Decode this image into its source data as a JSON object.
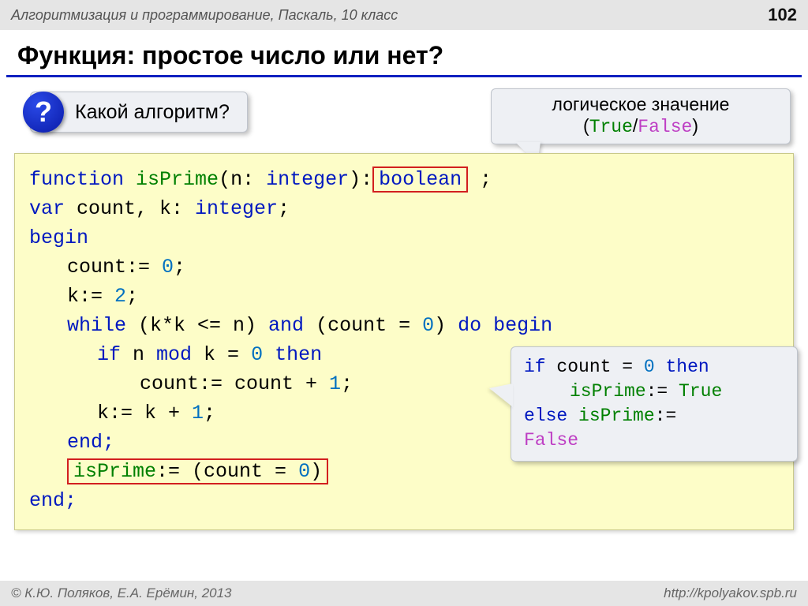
{
  "topbar": {
    "course": "Алгоритмизация и программирование, Паскаль, 10 класс",
    "page": "102"
  },
  "title": "Функция: простое число или нет?",
  "question": {
    "mark": "?",
    "text": "Какой алгоритм?"
  },
  "boolCallout": {
    "line1": "логическое значение",
    "true": "True",
    "sep": "/",
    "false": "False",
    "lp": "(",
    "rp": ")"
  },
  "code": {
    "l1_a": "function",
    "l1_b": "isPrime",
    "l1_c": "(n: ",
    "l1_d": "integer",
    "l1_e": "):",
    "l1_box": "boolean",
    "l1_f": " ;",
    "l2_a": "var",
    "l2_b": " count, k: ",
    "l2_c": "integer",
    "l2_d": ";",
    "l3": "begin",
    "l4_a": "count:= ",
    "l4_b": "0",
    "l4_c": ";",
    "l5_a": "k:= ",
    "l5_b": "2",
    "l5_c": ";",
    "l6_a": "while",
    "l6_b": " (k*k <= n) ",
    "l6_c": "and",
    "l6_d": " (count = ",
    "l6_e": "0",
    "l6_f": ") ",
    "l6_g": "do begin",
    "l7_a": "if",
    "l7_b": " n ",
    "l7_c": "mod",
    "l7_d": " k = ",
    "l7_e": "0",
    "l7_f": " ",
    "l7_g": "then",
    "l8_a": "count:= count + ",
    "l8_b": "1",
    "l8_c": ";",
    "l9_a": "k:= k + ",
    "l9_b": "1",
    "l9_c": ";",
    "l10": "end;",
    "l11_a": "isPrime",
    "l11_b": ":= (count = ",
    "l11_c": "0",
    "l11_d": ")",
    "l12": "end;"
  },
  "altCallout": {
    "a1": "if",
    "a2": " count = ",
    "a3": "0",
    "a4": " ",
    "a5": "then",
    "b1": "isPrime",
    "b2": ":= ",
    "b3": "True",
    "c1": "else",
    "c2": " ",
    "c3": "isPrime",
    "c4": ":= ",
    "d1": "False"
  },
  "footer": {
    "left": "© К.Ю. Поляков, Е.А. Ерёмин, 2013",
    "right": "http://kpolyakov.spb.ru"
  }
}
